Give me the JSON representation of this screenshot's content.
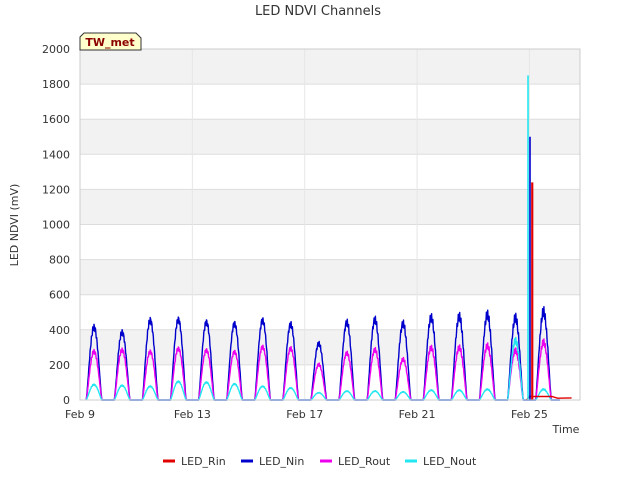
{
  "chart_data": {
    "type": "line",
    "title": "LED NDVI Channels",
    "xlabel": "Time",
    "ylabel": "LED NDVI (mV)",
    "badge": "TW_met",
    "ylim": [
      0,
      2000
    ],
    "yticks": [
      0,
      200,
      400,
      600,
      800,
      1000,
      1200,
      1400,
      1600,
      1800,
      2000
    ],
    "xlim_days": [
      9.0,
      26.8
    ],
    "xticks": [
      {
        "label": "Feb 9",
        "day": 9
      },
      {
        "label": "Feb 13",
        "day": 13
      },
      {
        "label": "Feb 17",
        "day": 17
      },
      {
        "label": "Feb 21",
        "day": 21
      },
      {
        "label": "Feb 25",
        "day": 25
      }
    ],
    "grid": true,
    "legend_position": "bottom",
    "day_peaks": [
      {
        "day": 9,
        "nin": 450,
        "rout": 300,
        "nout": 95
      },
      {
        "day": 10,
        "nin": 420,
        "rout": 310,
        "nout": 90
      },
      {
        "day": 11,
        "nin": 495,
        "rout": 300,
        "nout": 85
      },
      {
        "day": 12,
        "nin": 500,
        "rout": 320,
        "nout": 115
      },
      {
        "day": 13,
        "nin": 485,
        "rout": 310,
        "nout": 110
      },
      {
        "day": 14,
        "nin": 475,
        "rout": 300,
        "nout": 100
      },
      {
        "day": 15,
        "nin": 495,
        "rout": 330,
        "nout": 85
      },
      {
        "day": 16,
        "nin": 470,
        "rout": 320,
        "nout": 75
      },
      {
        "day": 17,
        "nin": 350,
        "rout": 220,
        "nout": 45
      },
      {
        "day": 18,
        "nin": 480,
        "rout": 290,
        "nout": 55
      },
      {
        "day": 19,
        "nin": 495,
        "rout": 310,
        "nout": 55
      },
      {
        "day": 20,
        "nin": 470,
        "rout": 250,
        "nout": 50
      },
      {
        "day": 21,
        "nin": 505,
        "rout": 320,
        "nout": 60
      },
      {
        "day": 22,
        "nin": 510,
        "rout": 320,
        "nout": 60
      },
      {
        "day": 23,
        "nin": 520,
        "rout": 330,
        "nout": 65
      },
      {
        "day": 24,
        "nin": 500,
        "rout": 300,
        "nout": 360
      },
      {
        "day": 25,
        "nin": 535,
        "rout": 350,
        "nout": 65
      }
    ],
    "spikes": [
      {
        "series": "LED_Nout",
        "day": 24.95,
        "value": 1850
      },
      {
        "series": "LED_Nin",
        "day": 25.02,
        "value": 1500
      },
      {
        "series": "LED_Rin",
        "day": 25.1,
        "value": 1240
      }
    ],
    "series": [
      {
        "name": "LED_Rin",
        "color": "#e00000"
      },
      {
        "name": "LED_Nin",
        "color": "#0000cc"
      },
      {
        "name": "LED_Rout",
        "color": "#ee00ee"
      },
      {
        "name": "LED_Nout",
        "color": "#22e6f0"
      }
    ]
  }
}
